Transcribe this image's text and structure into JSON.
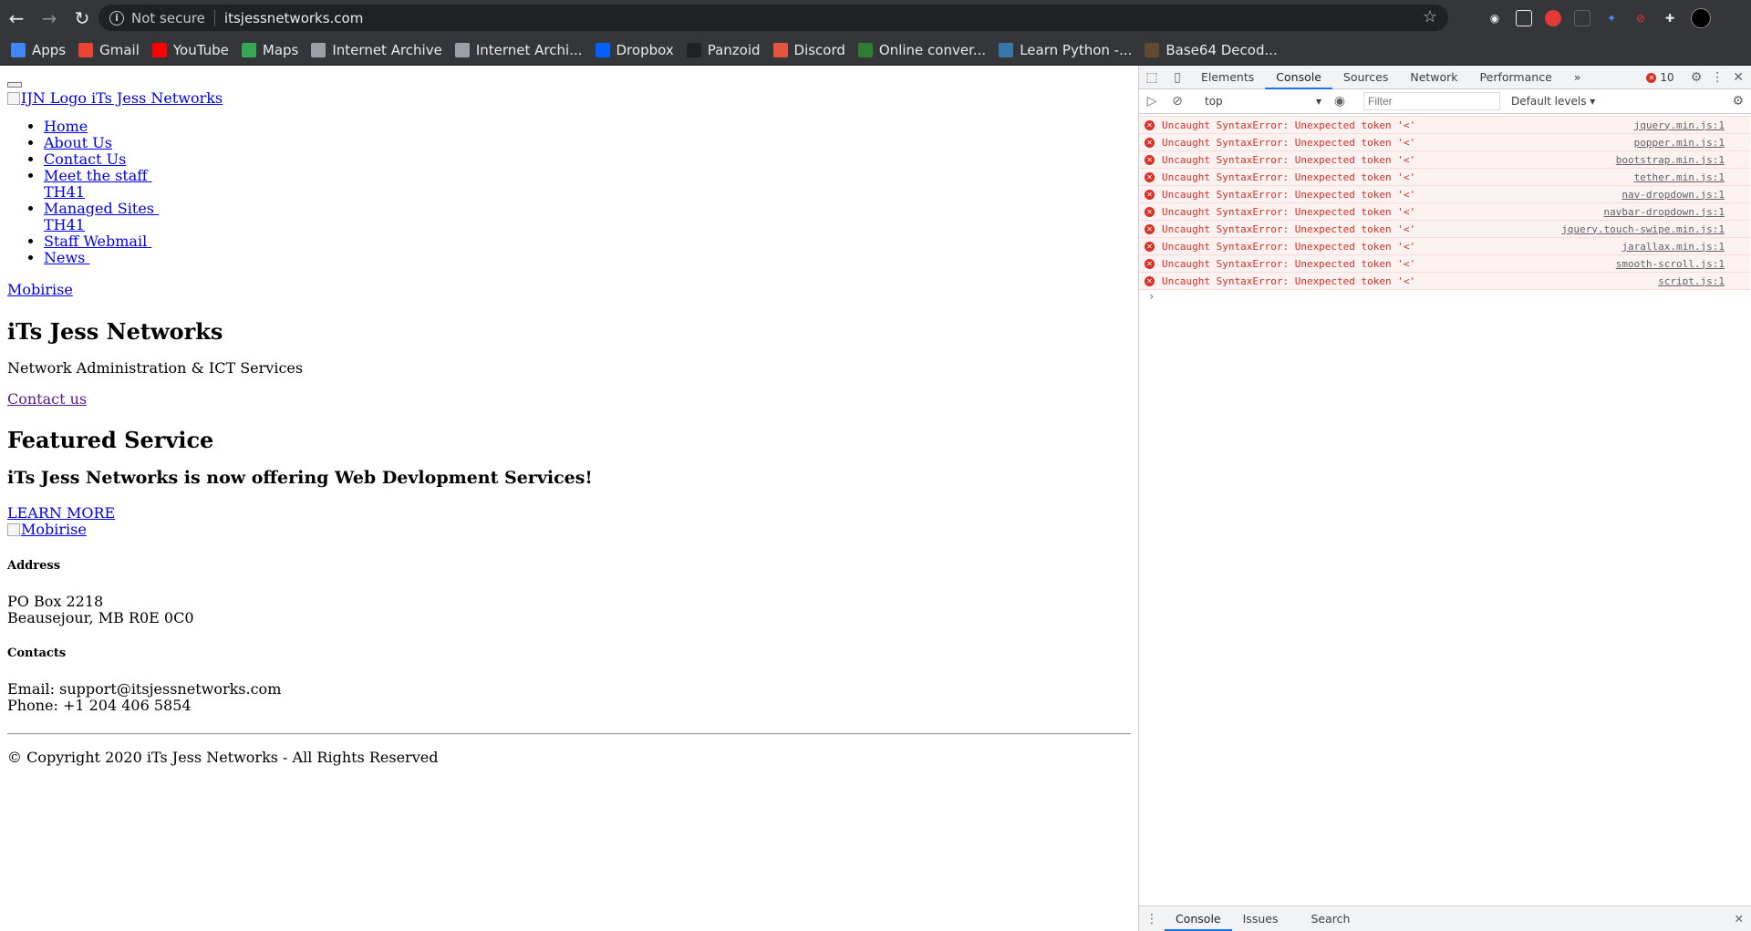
{
  "browser": {
    "back_icon": "←",
    "forward_icon": "→",
    "reload_icon": "↻",
    "security_label": "Not secure",
    "url": "itsjessnetworks.com",
    "bookmarks": [
      {
        "label": "Apps",
        "icon": "apps-grid",
        "color": "#4285f4"
      },
      {
        "label": "Gmail",
        "icon": "gmail",
        "color": "#ea4335"
      },
      {
        "label": "YouTube",
        "icon": "youtube",
        "color": "#ff0000"
      },
      {
        "label": "Maps",
        "icon": "maps-pin",
        "color": "#34a853"
      },
      {
        "label": "Internet Archive",
        "icon": "archive",
        "color": "#9aa0a6"
      },
      {
        "label": "Internet Archi...",
        "icon": "archive",
        "color": "#9aa0a6"
      },
      {
        "label": "Dropbox",
        "icon": "dropbox",
        "color": "#0061ff"
      },
      {
        "label": "Panzoid",
        "icon": "panzoid",
        "color": "#202124"
      },
      {
        "label": "Discord",
        "icon": "discord",
        "color": "#e5553d"
      },
      {
        "label": "Online conver...",
        "icon": "converter",
        "color": "#2e7d32"
      },
      {
        "label": "Learn Python -...",
        "icon": "python",
        "color": "#3776ab"
      },
      {
        "label": "Base64 Decod...",
        "icon": "base64",
        "color": "#5f4b32"
      }
    ]
  },
  "site": {
    "logo_alt": "IJN Logo",
    "brand": "iTs Jess Networks",
    "menu": {
      "home": "Home",
      "about": "About Us",
      "contact": "Contact Us",
      "staff": "Meet the staff",
      "staff_sub": "TH41",
      "managed": "Managed Sites",
      "managed_sub": "TH41",
      "webmail": "Staff Webmail",
      "news": "News"
    },
    "mobirise_link": "Mobirise",
    "hero_title": "iTs Jess Networks",
    "hero_subtitle": "Network Administration & ICT Services",
    "contact_link": "Contact us",
    "featured_title": "Featured Service",
    "featured_text": "iTs Jess Networks is now offering Web Devlopment Services!",
    "learn_more": "LEARN MORE",
    "mobirise_img_alt": "Mobirise",
    "address_heading": "Address",
    "address_line1": "PO Box 2218",
    "address_line2": "Beausejour, MB R0E 0C0",
    "contacts_heading": "Contacts",
    "email_line": "Email: support@itsjessnetworks.com",
    "phone_line": "Phone: +1 204 406 5854",
    "copyright": "© Copyright 2020 iTs Jess Networks - All Rights Reserved"
  },
  "devtools": {
    "tabs": [
      "Elements",
      "Console",
      "Sources",
      "Network",
      "Performance"
    ],
    "active_tab": "Console",
    "more_tabs": "»",
    "error_count": "10",
    "context": "top",
    "filter_placeholder": "Filter",
    "levels": "Default levels ▾",
    "messages": [
      {
        "text": "Uncaught SyntaxError: Unexpected token '<'",
        "source": "jquery.min.js:1"
      },
      {
        "text": "Uncaught SyntaxError: Unexpected token '<'",
        "source": "popper.min.js:1"
      },
      {
        "text": "Uncaught SyntaxError: Unexpected token '<'",
        "source": "bootstrap.min.js:1"
      },
      {
        "text": "Uncaught SyntaxError: Unexpected token '<'",
        "source": "tether.min.js:1"
      },
      {
        "text": "Uncaught SyntaxError: Unexpected token '<'",
        "source": "nav-dropdown.js:1"
      },
      {
        "text": "Uncaught SyntaxError: Unexpected token '<'",
        "source": "navbar-dropdown.js:1"
      },
      {
        "text": "Uncaught SyntaxError: Unexpected token '<'",
        "source": "jquery.touch-swipe.min.js:1"
      },
      {
        "text": "Uncaught SyntaxError: Unexpected token '<'",
        "source": "jarallax.min.js:1"
      },
      {
        "text": "Uncaught SyntaxError: Unexpected token '<'",
        "source": "smooth-scroll.js:1"
      },
      {
        "text": "Uncaught SyntaxError: Unexpected token '<'",
        "source": "script.js:1"
      }
    ],
    "prompt": "›",
    "drawer_tabs": [
      "Console",
      "Issues",
      "Search"
    ]
  },
  "colors": {
    "error_red": "#d93025",
    "accent_blue": "#1a73e8",
    "chrome_dark": "#35363a"
  }
}
